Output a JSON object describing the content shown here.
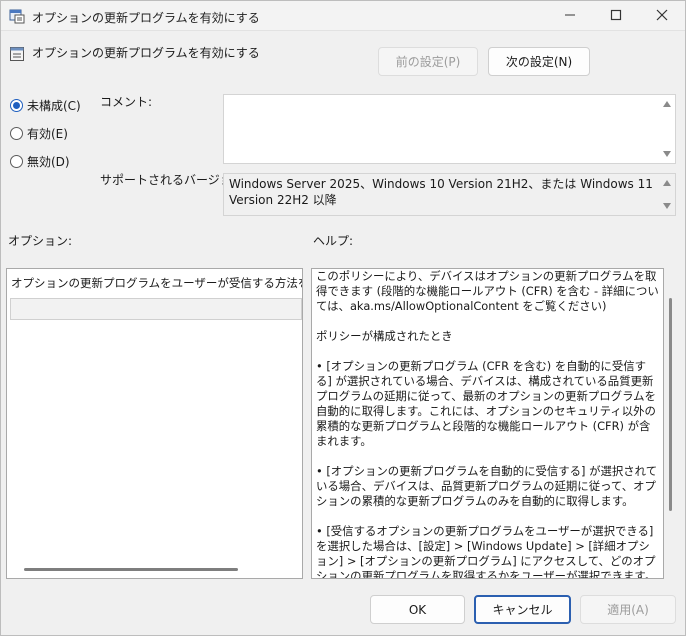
{
  "window": {
    "title": "オプションの更新プログラムを有効にする",
    "icon": "policy-settings-icon"
  },
  "header": {
    "title": "オプションの更新プログラムを有効にする",
    "icon": "policy-setting-icon"
  },
  "navigation": {
    "prev_label": "前の設定(P)",
    "next_label": "次の設定(N)"
  },
  "state": {
    "options": [
      {
        "label": "未構成(C)",
        "checked": true
      },
      {
        "label": "有効(E)",
        "checked": false
      },
      {
        "label": "無効(D)",
        "checked": false
      }
    ]
  },
  "comment": {
    "label": "コメント:",
    "value": ""
  },
  "supported": {
    "label": "サポートされるバージョン:",
    "value": "Windows Server 2025、Windows 10 Version 21H2、または Windows 11 Version 22H2 以降"
  },
  "options_pane": {
    "label": "オプション:",
    "text": "オプションの更新プログラムをユーザーが受信する方法を選択す",
    "combo_value": ""
  },
  "help_pane": {
    "label": "ヘルプ:",
    "paragraphs": [
      "このポリシーにより、デバイスはオプションの更新プログラムを取得できます (段階的な機能ロールアウト (CFR) を含む - 詳細については、aka.ms/AllowOptionalContent をご覧ください)",
      "ポリシーが構成されたとき",
      "• [オプションの更新プログラム (CFR を含む) を自動的に受信する] が選択されている場合、デバイスは、構成されている品質更新プログラムの延期に従って、最新のオプションの更新プログラムを自動的に取得します。これには、オプションのセキュリティ以外の累積的な更新プログラムと段階的な機能ロールアウト (CFR) が含まれます。",
      "• [オプションの更新プログラムを自動的に受信する] が選択されている場合、デバイスは、品質更新プログラムの延期に従って、オプションの累積的な更新プログラムのみを自動的に取得します。",
      "• [受信するオプションの更新プログラムをユーザーが選択できる] を選択した場合は、[設定] > [Windows Update] > [詳細オプション] > [オプションの更新プログラム] にアクセスして、どのオプションの更新プログラムを取得するかをユーザーが選択できます。また、ユーザーは、[利用可能になったらすぐに最新の更新プログラムを入手する] の切り替えを有効にして、オプションの"
    ]
  },
  "footer": {
    "ok_label": "OK",
    "cancel_label": "キャンセル",
    "apply_label": "適用(A)"
  }
}
